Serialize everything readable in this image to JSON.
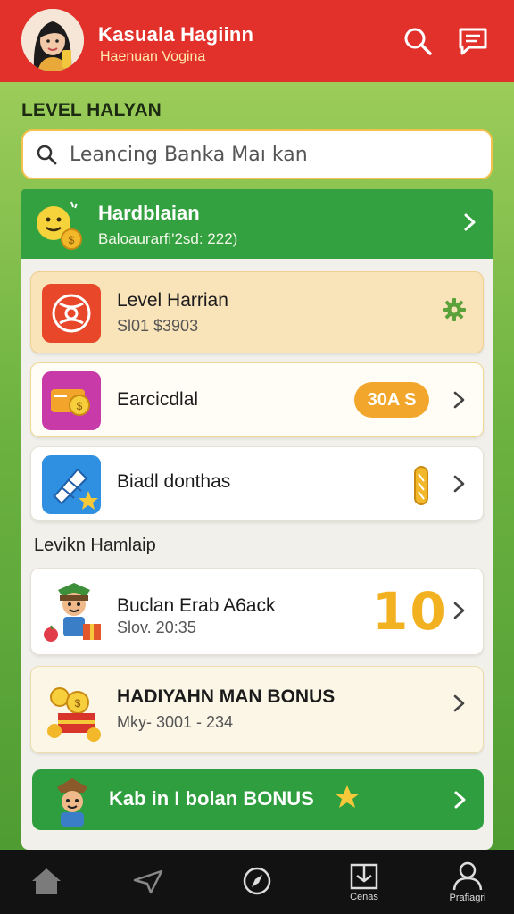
{
  "header": {
    "title": "Kasuala Hagiinn",
    "subtitle": "Haenuan Vogina"
  },
  "section_title": "LEVEL HALYAN",
  "search": {
    "placeholder": "Leancing Banka Maı kan"
  },
  "banner": {
    "title": "Hardblaian",
    "subtitle": "Baloaurarfi'2sd: 222)"
  },
  "cards": [
    {
      "title": "Level Harrian",
      "subtitle": "Sl01 $3903"
    },
    {
      "title": "Earcicdlal",
      "badge": "30A S"
    },
    {
      "title": "Biadl donthas"
    }
  ],
  "mid_section_title": "Levikn Hamlaip",
  "rewards": [
    {
      "title": "Buclan Erab A6ack",
      "subtitle": "Slov. 20:35",
      "badge": "10"
    },
    {
      "title": "HADIYAHN MAN BONUS",
      "subtitle": "Mky- 3001 - 234"
    }
  ],
  "bonus_bar": {
    "label": "Kab in I bolan BONUS"
  },
  "nav": [
    {
      "icon": "home-icon",
      "label": ""
    },
    {
      "icon": "send-icon",
      "label": ""
    },
    {
      "icon": "compass-icon",
      "label": ""
    },
    {
      "icon": "gift-icon",
      "label": "Cenas"
    },
    {
      "icon": "profile-icon",
      "label": "Prafiagri"
    }
  ],
  "colors": {
    "header": "#e2302b",
    "accent_green": "#34a140",
    "badge_orange": "#f2a72c"
  }
}
